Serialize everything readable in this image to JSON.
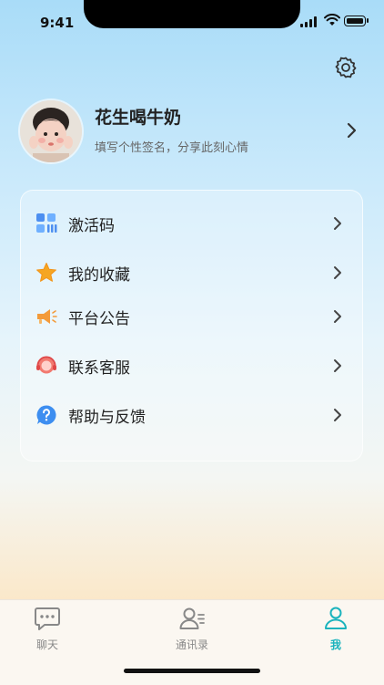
{
  "status_bar": {
    "time": "9:41"
  },
  "profile": {
    "name": "花生喝牛奶",
    "signature": "填写个性签名，分享此刻心情"
  },
  "menu": [
    {
      "label": "激活码",
      "icon": "grid-icon"
    },
    {
      "label": "我的收藏",
      "icon": "star-icon"
    },
    {
      "label": "平台公告",
      "icon": "megaphone-icon"
    },
    {
      "label": "联系客服",
      "icon": "headset-icon"
    },
    {
      "label": "帮助与反馈",
      "icon": "help-icon"
    }
  ],
  "tabs": [
    {
      "label": "聊天",
      "icon": "chat-icon",
      "active": false
    },
    {
      "label": "通讯录",
      "icon": "contacts-icon",
      "active": false
    },
    {
      "label": "我",
      "icon": "profile-icon",
      "active": true
    }
  ],
  "colors": {
    "accent": "#1ab3bd",
    "star": "#f5a623",
    "grid": "#4d8ff0",
    "help": "#3d8ef0",
    "headset": "#ef5a5a",
    "megaphone": "#f39a3a"
  }
}
